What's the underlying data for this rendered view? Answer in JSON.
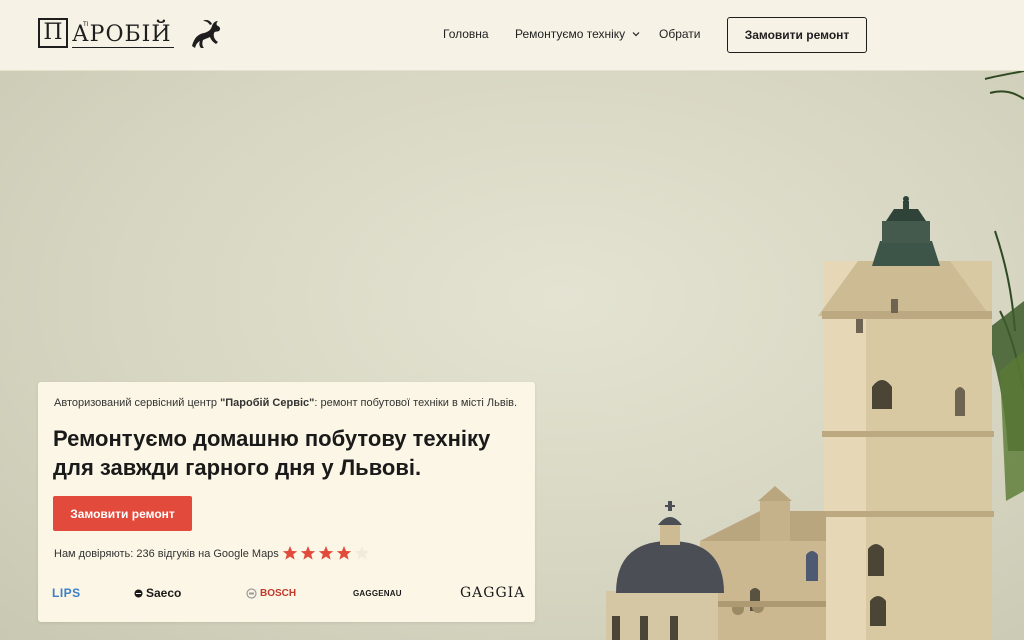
{
  "brand": {
    "logo_letter": "П",
    "logo_small": "ТІ",
    "logo_word": "АРОБІЙ"
  },
  "nav": {
    "home": "Головна",
    "repair": "Ремонтуємо техніку",
    "favorites": "Обрати",
    "cta": "Замовити ремонт"
  },
  "hero": {
    "subtitle_prefix": "Авторизований сервісний центр ",
    "subtitle_brand": "\"Паробій Сервіс\"",
    "subtitle_suffix": ": ремонт побутової техніки в місті Львів.",
    "title": "Ремонтуємо домашню побутову техніку для завжди гарного дня у Львові.",
    "cta": "Замовити ремонт",
    "trust_text": "Нам довіряють: 236 відгуків на Google Maps",
    "rating": 4,
    "rating_max": 5
  },
  "brands": [
    "LIPS",
    "Saeco",
    "BOSCH",
    "GAGGENAU",
    "GAGGIA"
  ],
  "colors": {
    "accent": "#e24a3b",
    "background": "#f6f2e6",
    "card": "#fbf6e5",
    "text": "#1a1a1a"
  }
}
